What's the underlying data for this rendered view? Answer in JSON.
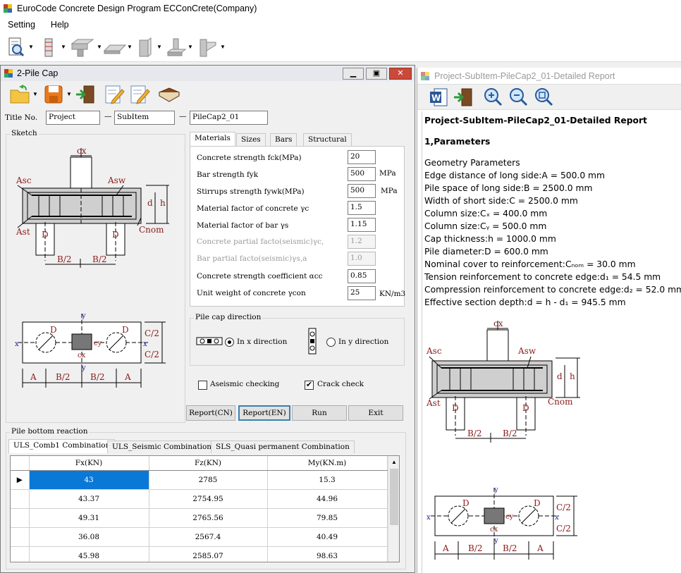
{
  "app": {
    "title": "EuroCode Concrete Design Program ECConCrete(Company)"
  },
  "menu": [
    "Setting",
    "Help"
  ],
  "child": {
    "title": "2-Pile Cap",
    "title_no_label": "Title No.",
    "title_fields": [
      "Project",
      "SubItem",
      "PileCap2_01"
    ],
    "sketch_label": "Sketch",
    "tabs": [
      "Materials",
      "Sizes",
      "Bars",
      "Structural"
    ],
    "materials": [
      {
        "label": "Concrete strength fck(MPa)",
        "value": "20",
        "unit": "",
        "enabled": true
      },
      {
        "label": "Bar strength fyk",
        "value": "500",
        "unit": "MPa",
        "enabled": true
      },
      {
        "label": "Stirrups strength fywk(MPa)",
        "value": "500",
        "unit": "MPa",
        "enabled": true
      },
      {
        "label": "Material factor of concrete γc",
        "value": "1.5",
        "unit": "",
        "enabled": true
      },
      {
        "label": "Material factor of bar γs",
        "value": "1.15",
        "unit": "",
        "enabled": true
      },
      {
        "label": "Concrete partial facto(seismic)γc,",
        "value": "1.2",
        "unit": "",
        "enabled": false
      },
      {
        "label": "Bar partial facto(seismic)γs,a",
        "value": "1.0",
        "unit": "",
        "enabled": false
      },
      {
        "label": "Concrete strength coefficient αcc",
        "value": "0.85",
        "unit": "",
        "enabled": true
      },
      {
        "label": "Unit weight of concrete γcon",
        "value": "25",
        "unit": "KN/m3",
        "enabled": true
      }
    ],
    "direction": {
      "group_label": "Pile cap direction",
      "x_label": "In x direction",
      "y_label": "In y direction",
      "selected": "x"
    },
    "aseismic_label": "Aseismic checking",
    "aseismic_checked": false,
    "crack_label": "Crack check",
    "crack_checked": true,
    "buttons": [
      "Report(CN)",
      "Report(EN)",
      "Run",
      "Exit"
    ],
    "reaction": {
      "group_label": "Pile bottom reaction",
      "tabs": [
        "ULS_Comb1 Combination",
        "ULS_Seismic Combination",
        "SLS_Quasi permanent Combination"
      ],
      "columns": [
        "Fx(KN)",
        "Fz(KN)",
        "My(KN.m)"
      ],
      "rows": [
        [
          "43",
          "2785",
          "15.3"
        ],
        [
          "43.37",
          "2754.95",
          "44.96"
        ],
        [
          "49.31",
          "2765.56",
          "79.85"
        ],
        [
          "36.08",
          "2567.4",
          "40.49"
        ],
        [
          "45.98",
          "2585.07",
          "98.63"
        ]
      ]
    }
  },
  "sketch_labels": {
    "cx": "cx",
    "cy": "cy",
    "asc": "Asc",
    "asw": "Asw",
    "ast": "Ast",
    "d": "D",
    "dd": "d",
    "h": "h",
    "cnom": "Cnom",
    "b2": "B/2",
    "a": "A",
    "c2": "C/2",
    "x": "x",
    "y": "y"
  },
  "report": {
    "title": "Project-SubItem-PileCap2_01-Detailed Report",
    "heading": "Project-SubItem-PileCap2_01-Detailed Report",
    "section": "1,Parameters",
    "subheading": "Geometry Parameters",
    "lines": [
      "Edge distance of long side:A = 500.0 mm",
      "Pile space of long side:B = 2500.0 mm",
      "Width of short side:C = 2500.0 mm",
      "Column size:Cₓ = 400.0 mm",
      "Column size:Cᵧ = 500.0 mm",
      "Cap thickness:h = 1000.0 mm",
      "Pile diameter:D = 600.0 mm",
      "Nominal cover to reinforcement:Cₙₒₘ = 30.0 mm",
      "Tension reinforcement to concrete edge:d₁ = 54.5 mm",
      "Compression reinforcement to concrete edge:d₂ = 52.0 mm",
      "Effective section depth:d = h - d₁ = 945.5 mm"
    ]
  }
}
